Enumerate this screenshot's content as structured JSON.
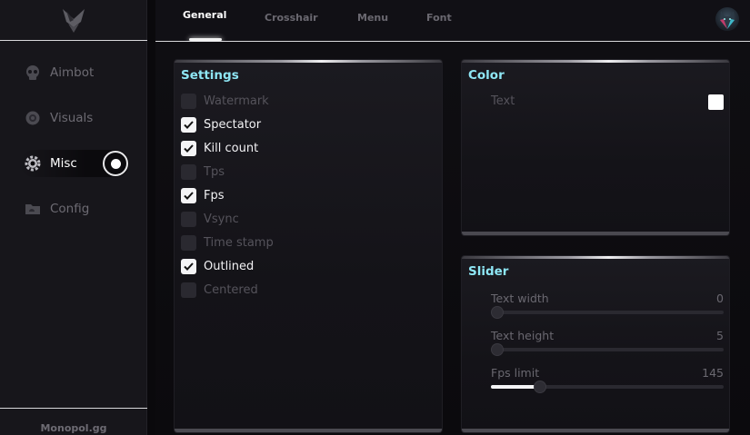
{
  "sidebar": {
    "items": [
      {
        "label": "Aimbot",
        "icon": "skull-icon"
      },
      {
        "label": "Visuals",
        "icon": "eye-icon"
      },
      {
        "label": "Misc",
        "icon": "gear-icon",
        "active": true
      },
      {
        "label": "Config",
        "icon": "folder-icon"
      }
    ],
    "brand": "Monopol.gg"
  },
  "tabs": [
    {
      "label": "General",
      "active": true
    },
    {
      "label": "Crosshair"
    },
    {
      "label": "Menu"
    },
    {
      "label": "Font"
    }
  ],
  "settings": {
    "title": "Settings",
    "options": [
      {
        "label": "Watermark",
        "checked": false
      },
      {
        "label": "Spectator",
        "checked": true
      },
      {
        "label": "Kill count",
        "checked": true
      },
      {
        "label": "Tps",
        "checked": false
      },
      {
        "label": "Fps",
        "checked": true
      },
      {
        "label": "Vsync",
        "checked": false
      },
      {
        "label": "Time stamp",
        "checked": false
      },
      {
        "label": "Outlined",
        "checked": true
      },
      {
        "label": "Centered",
        "checked": false
      }
    ]
  },
  "color": {
    "title": "Color",
    "rows": [
      {
        "label": "Text",
        "value": "#ffffff"
      }
    ]
  },
  "slider": {
    "title": "Slider",
    "items": [
      {
        "label": "Text width",
        "value": "0",
        "fraction": 0.0
      },
      {
        "label": "Text height",
        "value": "5",
        "fraction": 0.0
      },
      {
        "label": "Fps limit",
        "value": "145",
        "fraction": 0.21
      }
    ]
  },
  "colors": {
    "accent": "#8ee6f4",
    "checkbox_on": "#f4f4f6",
    "checkbox_off": "#2a2930"
  }
}
